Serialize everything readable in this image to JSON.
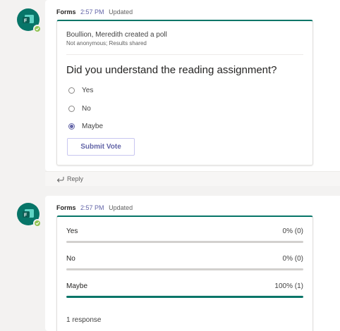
{
  "colors": {
    "accent": "#6264a7",
    "forms_brand": "#077568",
    "presence_available": "#92c353",
    "page_background": "#f3f2f1"
  },
  "messages": [
    {
      "avatar_icon": "forms-app-icon",
      "presence_icon": "checkmark-icon",
      "sender": "Forms",
      "time": "2:57 PM",
      "status": "Updated",
      "poll": {
        "creator_line": "Boullion, Meredith created a poll",
        "settings_line": "Not anonymous; Results shared",
        "question": "Did you understand the reading assignment?",
        "options": [
          {
            "label": "Yes",
            "selected": false
          },
          {
            "label": "No",
            "selected": false
          },
          {
            "label": "Maybe",
            "selected": true
          }
        ],
        "submit_label": "Submit Vote"
      },
      "reply": {
        "icon": "reply-arrow-icon",
        "label": "Reply"
      }
    },
    {
      "avatar_icon": "forms-app-icon",
      "presence_icon": "checkmark-icon",
      "sender": "Forms",
      "time": "2:57 PM",
      "status": "Updated",
      "results": {
        "rows": [
          {
            "label": "Yes",
            "value_text": "0% (0)",
            "percent": 0
          },
          {
            "label": "No",
            "value_text": "0% (0)",
            "percent": 0
          },
          {
            "label": "Maybe",
            "value_text": "100% (1)",
            "percent": 100
          }
        ],
        "response_count": "1 response"
      }
    }
  ]
}
